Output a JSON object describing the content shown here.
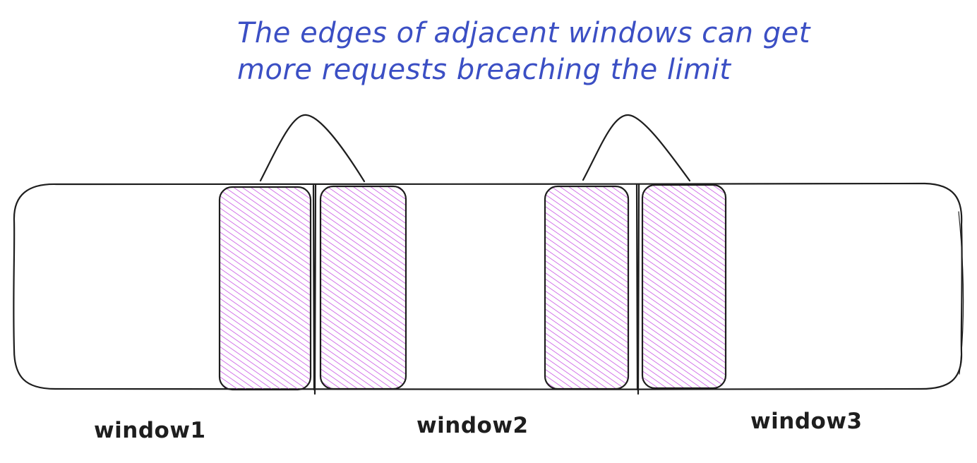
{
  "annotation": {
    "line1": "The edges of adjacent windows can get",
    "line2": "more requests breaching the limit",
    "color": "#3b4fc4"
  },
  "windows": [
    {
      "label": "window1"
    },
    {
      "label": "window2"
    },
    {
      "label": "window3"
    }
  ],
  "colors": {
    "stroke": "#1e1e1e",
    "hatch": "#c13ee0",
    "background": "#ffffff"
  }
}
